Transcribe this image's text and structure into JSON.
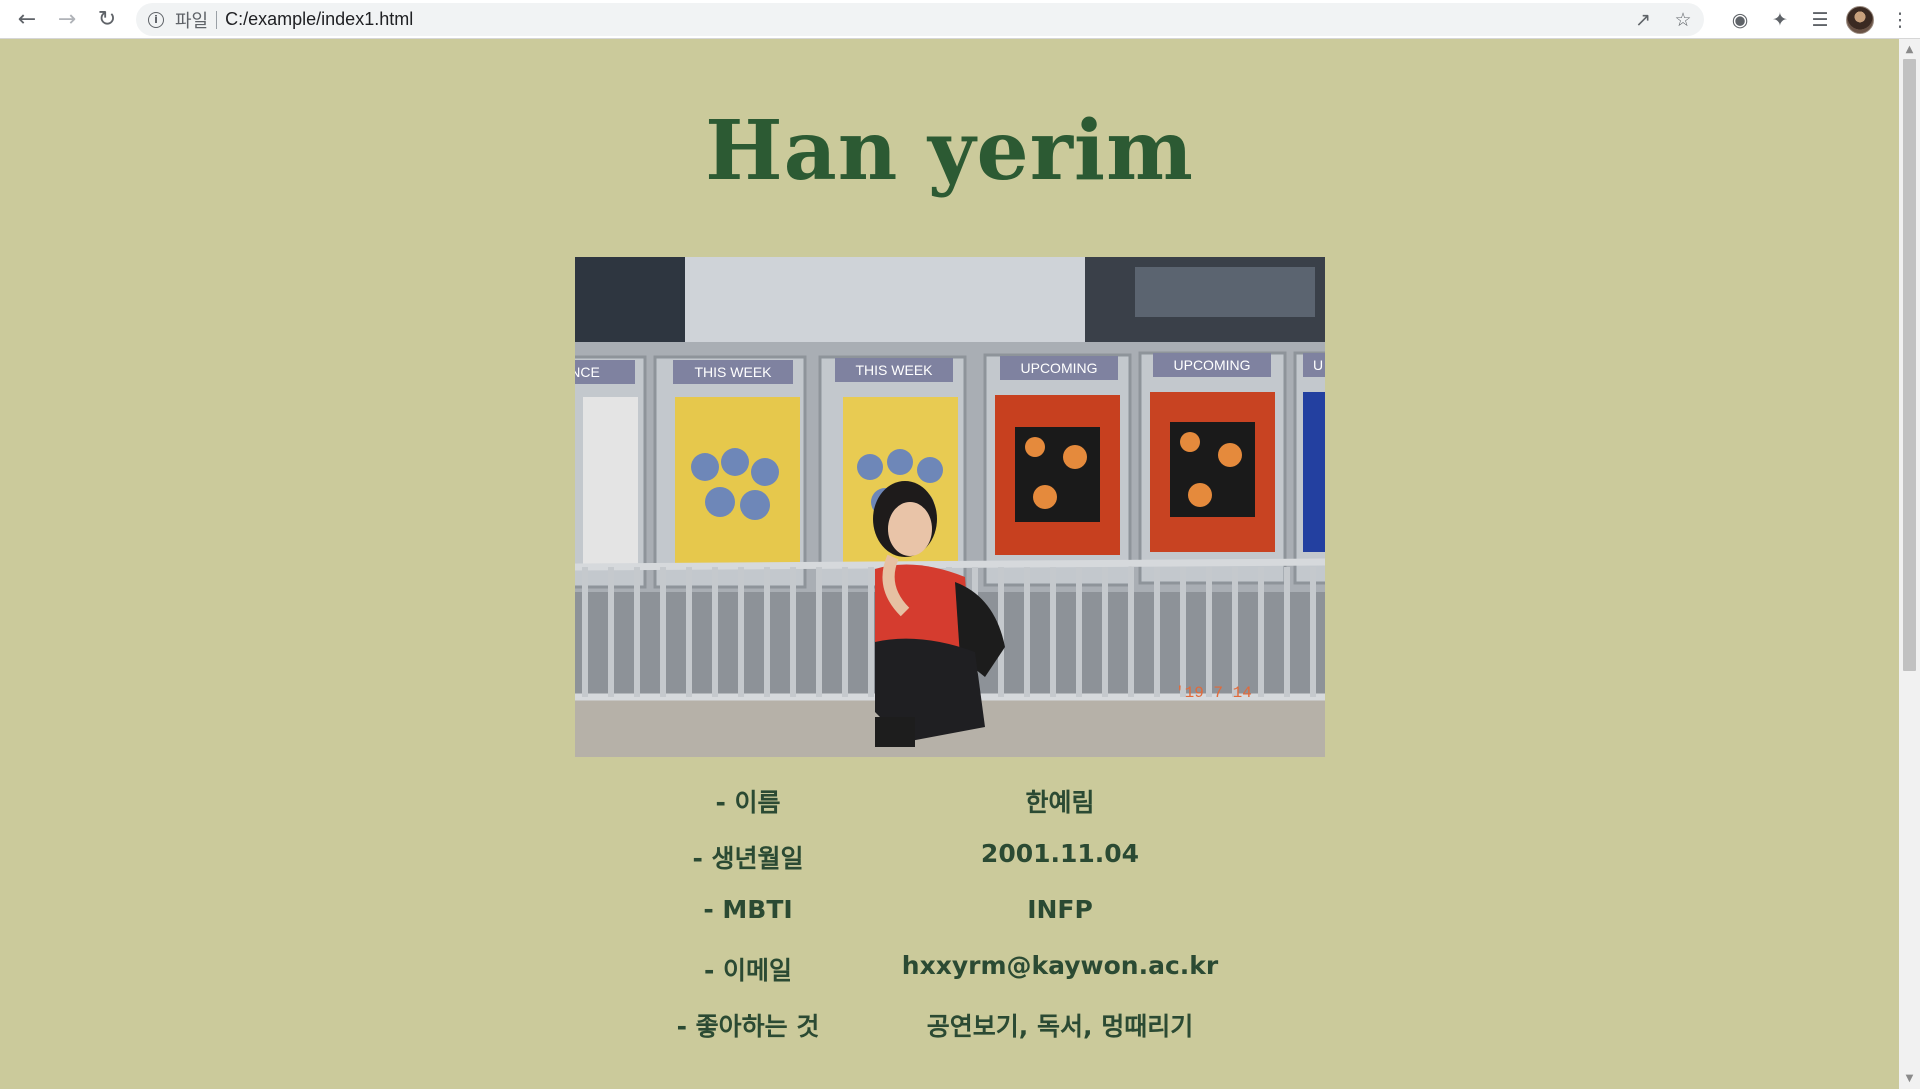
{
  "browser": {
    "scheme_label": "파일",
    "url": "C:/example/index1.html",
    "icons": {
      "back": "back-arrow-icon",
      "forward": "forward-arrow-icon",
      "reload": "reload-icon",
      "site_info": "info-icon",
      "share": "share-icon",
      "bookmark": "star-icon",
      "screenshot": "camera-icon",
      "extensions": "puzzle-icon",
      "reading_list": "reading-list-icon",
      "profile": "avatar",
      "menu": "kebab-menu-icon"
    }
  },
  "page": {
    "title": "Han yerim",
    "background": "#cbca9b",
    "title_color": "#2c5a33",
    "info": [
      {
        "label": "- 이름",
        "value": "한예림"
      },
      {
        "label": "- 생년월일",
        "value": "2001.11.04"
      },
      {
        "label": "- MBTI",
        "value": "INFP"
      },
      {
        "label": "- 이메일",
        "value": "hxxyrm@kaywon.ac.kr"
      },
      {
        "label": "- 좋아하는 것",
        "value": "공연보기, 독서, 멍때리기"
      }
    ],
    "photo_signs": [
      "NCE",
      "THIS WEEK",
      "THIS WEEK",
      "UPCOMING",
      "UPCOMING",
      "U"
    ]
  }
}
